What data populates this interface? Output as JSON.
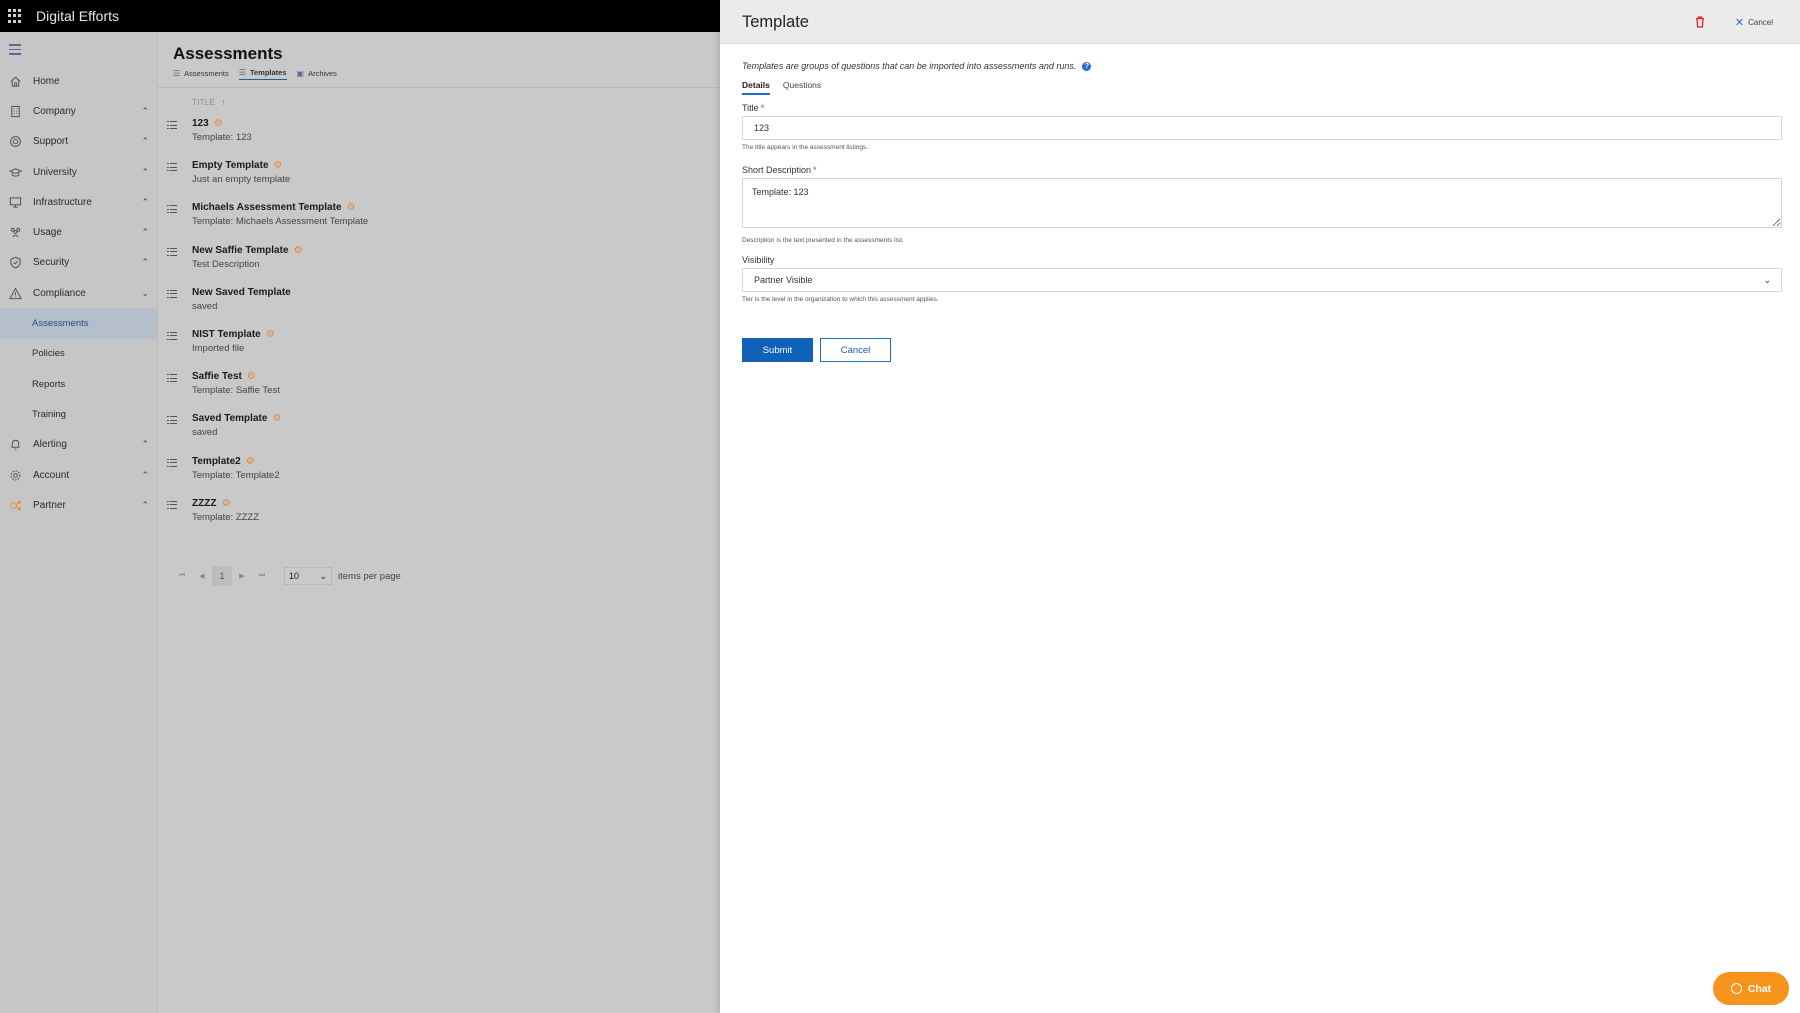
{
  "app": {
    "brand": "Digital Efforts"
  },
  "sidebar": {
    "items": [
      {
        "label": "Home",
        "icon": "home-icon",
        "chevron": ""
      },
      {
        "label": "Company",
        "icon": "building-icon",
        "chevron": "^"
      },
      {
        "label": "Support",
        "icon": "lifebuoy-icon",
        "chevron": "^"
      },
      {
        "label": "University",
        "icon": "graduation-cap-icon",
        "chevron": "^"
      },
      {
        "label": "Infrastructure",
        "icon": "monitor-icon",
        "chevron": "^"
      },
      {
        "label": "Usage",
        "icon": "people-icon",
        "chevron": "^"
      },
      {
        "label": "Security",
        "icon": "shield-icon",
        "chevron": "^"
      },
      {
        "label": "Compliance",
        "icon": "warning-icon",
        "chevron": "v"
      }
    ],
    "compliance_sub": [
      {
        "label": "Assessments",
        "active": true
      },
      {
        "label": "Policies",
        "active": false
      },
      {
        "label": "Reports",
        "active": false
      },
      {
        "label": "Training",
        "active": false
      }
    ],
    "items_after": [
      {
        "label": "Alerting",
        "icon": "bell-icon",
        "chevron": "^"
      },
      {
        "label": "Account",
        "icon": "gear-icon",
        "chevron": "^"
      },
      {
        "label": "Partner",
        "icon": "partner-icon",
        "chevron": "^"
      }
    ]
  },
  "main": {
    "title": "Assessments",
    "tabs": [
      {
        "label": "Assessments",
        "active": false
      },
      {
        "label": "Templates",
        "active": true
      },
      {
        "label": "Archives",
        "active": false
      }
    ],
    "column_header": "TITLE",
    "sort_indicator": "↑",
    "rows": [
      {
        "title": "123",
        "desc": "Template: 123"
      },
      {
        "title": "Empty Template",
        "desc": "Just an empty template"
      },
      {
        "title": "Michaels Assessment Template",
        "desc": "Template: Michaels Assessment Template"
      },
      {
        "title": "New Saffie Template",
        "desc": "Test Description"
      },
      {
        "title": "New Saved Template",
        "desc": "saved",
        "no_gear": true
      },
      {
        "title": "NIST Template",
        "desc": "Imported file"
      },
      {
        "title": "Saffie Test",
        "desc": "Template: Saffie Test"
      },
      {
        "title": "Saved Template",
        "desc": "saved"
      },
      {
        "title": "Template2",
        "desc": "Template: Template2"
      },
      {
        "title": "ZZZZ",
        "desc": "Template: ZZZZ"
      }
    ],
    "pager": {
      "current_page": "1",
      "page_size": "10",
      "items_per_page_label": "items per page"
    }
  },
  "panel": {
    "title": "Template",
    "cancel_label": "Cancel",
    "intro": "Templates are groups of questions that can be imported into assessments and runs.",
    "help_glyph": "?",
    "tabs": [
      {
        "label": "Details",
        "active": true
      },
      {
        "label": "Questions",
        "active": false
      }
    ],
    "fields": {
      "title": {
        "label": "Title",
        "required": "*",
        "value": "123",
        "help": "The title appears in the assessment listings."
      },
      "short_description": {
        "label": "Short Description",
        "required": "*",
        "value": "Template: 123",
        "help": "Description is the text presented in the assessments list."
      },
      "visibility": {
        "label": "Visibility",
        "value": "Partner Visible",
        "help": "Tier is the level in the organization to which this assessment applies."
      }
    },
    "submit_label": "Submit",
    "form_cancel_label": "Cancel"
  },
  "chat": {
    "label": "Chat"
  },
  "colors": {
    "accent": "#0f62b8",
    "chat": "#f7941d",
    "danger": "#d9342b",
    "gear": "#e08a3c"
  }
}
